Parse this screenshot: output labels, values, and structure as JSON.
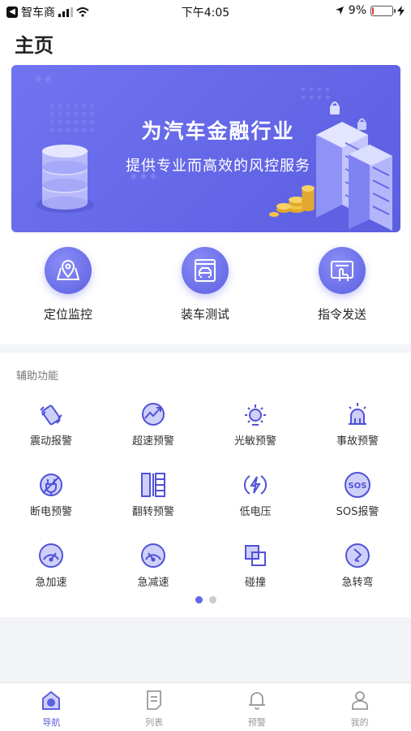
{
  "status": {
    "carrier": "智车商",
    "time": "下午4:05",
    "battery": "9%",
    "battery_level": 0.09
  },
  "page": {
    "title": "主页"
  },
  "banner": {
    "title": "为汽车金融行业",
    "subtitle": "提供专业而高效的风控服务"
  },
  "main_actions": [
    {
      "label": "定位监控",
      "icon": "location-monitor-icon"
    },
    {
      "label": "装车测试",
      "icon": "install-test-icon"
    },
    {
      "label": "指令发送",
      "icon": "command-send-icon"
    }
  ],
  "aux": {
    "title": "辅助功能",
    "items": [
      {
        "label": "震动报警",
        "icon": "vibration-icon"
      },
      {
        "label": "超速预警",
        "icon": "overspeed-icon"
      },
      {
        "label": "光敏预警",
        "icon": "light-sensor-icon"
      },
      {
        "label": "事故预警",
        "icon": "accident-icon"
      },
      {
        "label": "断电预警",
        "icon": "power-off-icon"
      },
      {
        "label": "翻转预警",
        "icon": "flip-icon"
      },
      {
        "label": "低电压",
        "icon": "low-voltage-icon"
      },
      {
        "label": "SOS报警",
        "icon": "sos-icon"
      },
      {
        "label": "急加速",
        "icon": "hard-acceleration-icon"
      },
      {
        "label": "急减速",
        "icon": "hard-braking-icon"
      },
      {
        "label": "碰撞",
        "icon": "collision-icon"
      },
      {
        "label": "急转弯",
        "icon": "sharp-turn-icon"
      }
    ]
  },
  "tabs": [
    {
      "label": "导航",
      "icon": "home-icon",
      "active": true
    },
    {
      "label": "列表",
      "icon": "list-icon",
      "active": false
    },
    {
      "label": "预警",
      "icon": "bell-icon",
      "active": false
    },
    {
      "label": "我的",
      "icon": "user-icon",
      "active": false
    }
  ],
  "colors": {
    "accent": "#5b5fe0",
    "icon_stroke": "#4f52d6",
    "icon_fill": "#cfd0fa"
  }
}
